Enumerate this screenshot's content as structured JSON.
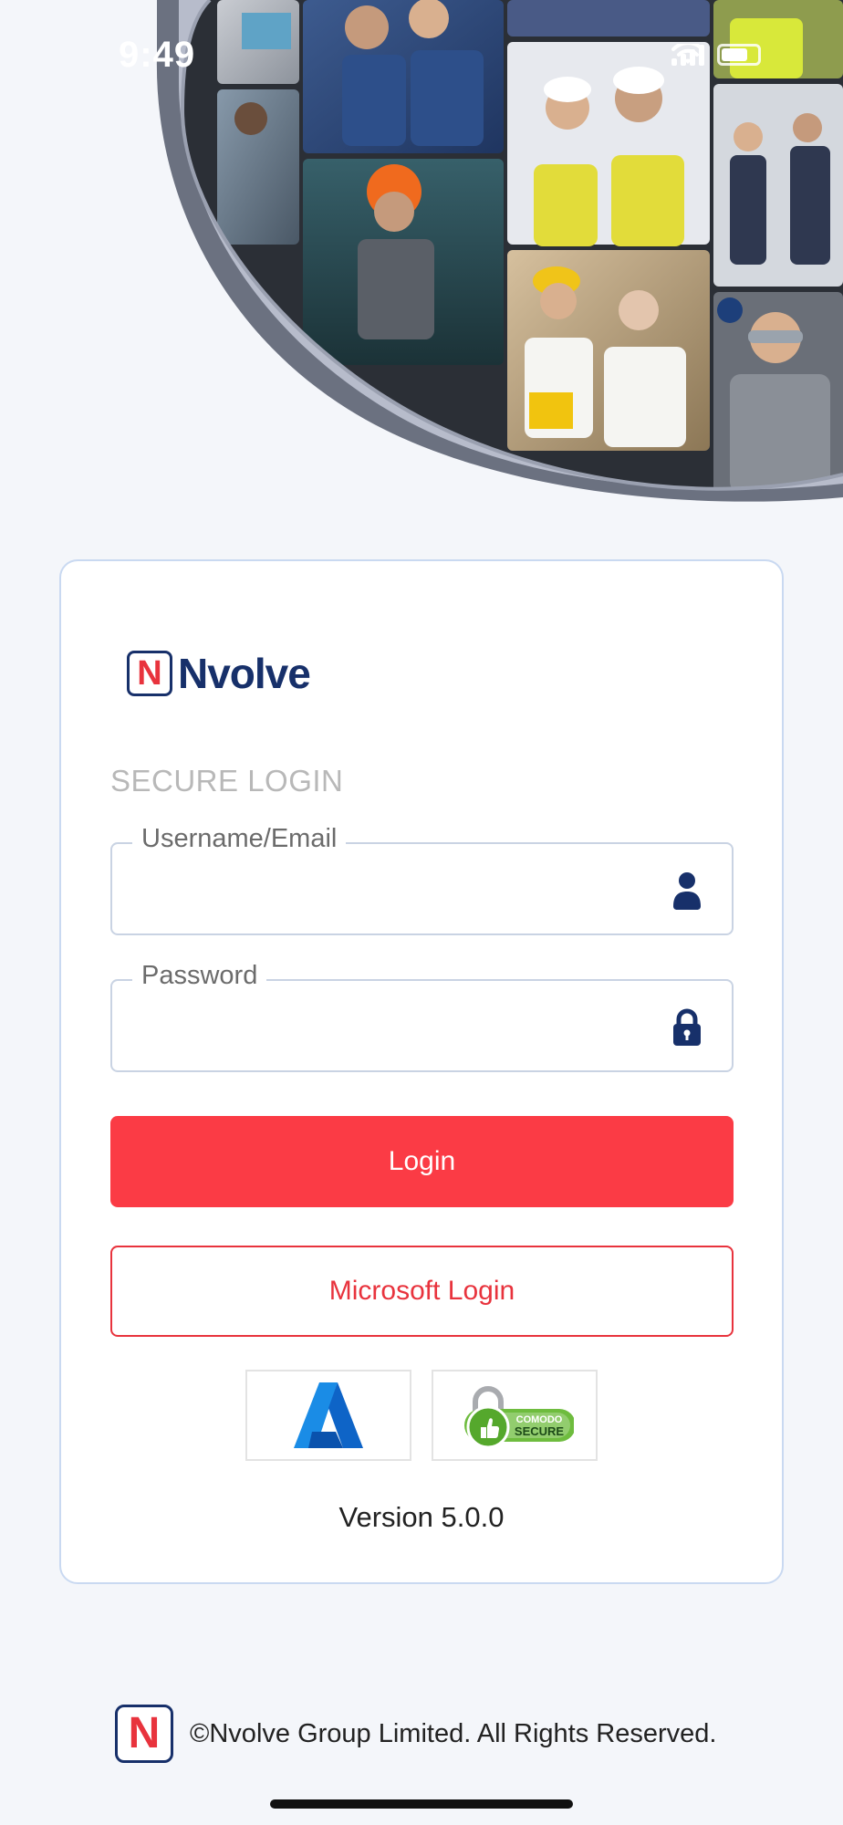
{
  "status_bar": {
    "time": "9:49"
  },
  "brand": {
    "logo_letter": "N",
    "logo_text": "Nvolve"
  },
  "login": {
    "title": "SECURE LOGIN",
    "username_label": "Username/Email",
    "username_value": "",
    "password_label": "Password",
    "password_value": "",
    "login_button": "Login",
    "microsoft_button": "Microsoft Login",
    "comodo_line1": "COMODO",
    "comodo_line2": "SECURE",
    "version": "Version 5.0.0"
  },
  "footer": {
    "logo_letter": "N",
    "copyright": "©Nvolve Group Limited. All Rights Reserved."
  },
  "colors": {
    "accent_red": "#fb3b45",
    "brand_navy": "#17306a",
    "card_border": "#c9d9f1"
  },
  "icons": [
    "user-icon",
    "lock-icon",
    "azure-logo-icon",
    "comodo-secure-icon"
  ]
}
